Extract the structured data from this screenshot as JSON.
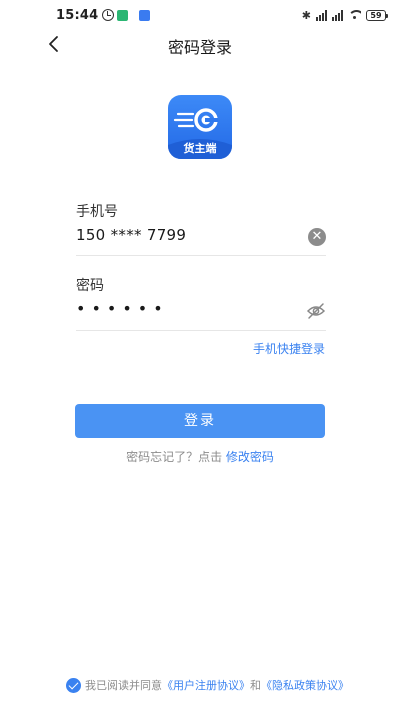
{
  "status_bar": {
    "time": "15:44",
    "battery": "59",
    "icons": [
      "alarm-icon",
      "app-notification-icon",
      "bluetooth-icon",
      "signal-icon",
      "wifi-icon",
      "battery-icon"
    ]
  },
  "nav": {
    "title": "密码登录",
    "back_icon": "chevron-left-icon"
  },
  "logo": {
    "text": "货主端"
  },
  "form": {
    "phone_label": "手机号",
    "phone_value": "150 **** 7799",
    "password_label": "密码",
    "password_value": "••••••",
    "clear_icon": "clear-icon",
    "visibility_icon": "eye-off-icon",
    "quick_login": "手机快捷登录",
    "login_button": "登录",
    "forgot_text": "密码忘记了？点击",
    "change_password": "修改密码"
  },
  "agreement": {
    "checked": true,
    "prefix": "我已阅读并同意",
    "user_agreement": "《用户注册协议》",
    "and": "和",
    "privacy_policy": "《隐私政策协议》"
  },
  "colors": {
    "accent": "#3a82f0",
    "button": "#4a93f3",
    "logo": "#2f79ee"
  }
}
